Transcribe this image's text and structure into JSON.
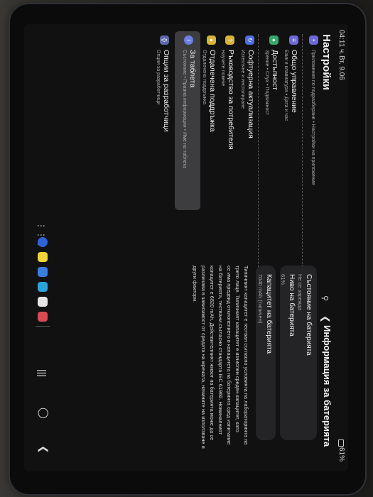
{
  "status_bar": {
    "time": "04:11 ч.",
    "date": "Вт, 9.06",
    "battery": "61%"
  },
  "left_panel": {
    "title": "Настройки",
    "suggestion": "Приложения по подразбиране • Настройки на приложение",
    "items": [
      {
        "title": "Общо управление",
        "subtitle": "Език и клавиатура • Дата и час",
        "icon": "sliders-icon",
        "color": "#6d6cd6"
      },
      {
        "title": "Достъпност",
        "subtitle": "Зрение • Слух • Подвижност",
        "icon": "accessibility-icon",
        "color": "#36a86a"
      },
      {
        "title": "Софтуерна актуализация",
        "subtitle": "Изтегляне и инсталиране",
        "icon": "update-icon",
        "color": "#4f6ee0"
      },
      {
        "title": "Ръководство за потребителя",
        "subtitle": "Научете повече",
        "icon": "book-icon",
        "color": "#d9b23a"
      },
      {
        "title": "Отдалечена поддръжка",
        "subtitle": "Отдалечена поддръжка",
        "icon": "support-icon",
        "color": "#d6b437"
      },
      {
        "title": "За таблета",
        "subtitle": "Състояние • Правна информация • Име на таблета",
        "icon": "info-icon",
        "color": "#6b7fe6"
      },
      {
        "title": "Опции за разработчици",
        "subtitle": "Опции за разработчици",
        "icon": "braces-icon",
        "color": "#5d6aa8"
      }
    ]
  },
  "right_panel": {
    "title": "Информация за батерията",
    "card1": [
      {
        "label": "Състояние на батерията",
        "value": "Не се зарежда"
      },
      {
        "label": "Ниво на батерията",
        "value": "61%"
      }
    ],
    "card2": {
      "label": "Капацитет на батерията",
      "value": "7040 mAh (типичен)"
    },
    "note_lines": [
      "Типичният капацитет е тестван съгласно условията на лабораторията на",
      "трето лице. Типичният капацитет е изчислен среден капацитет, като",
      "се има предвид отклонението в капацитета на батерията сред изпитание",
      "на батерията, тествани съгласно стандарта IEC 61960. Номиналният",
      "капацитет е 6820 mAh. Действителният живот на батерията може да се",
      "различава в зависимост от средата на мрежата, начините на използване и",
      "други фактори."
    ]
  }
}
